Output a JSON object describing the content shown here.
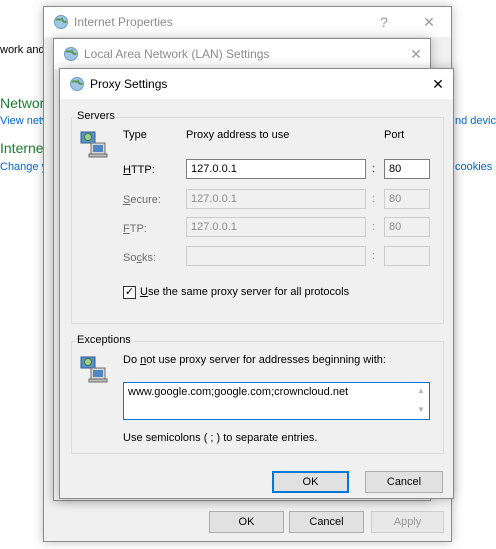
{
  "background_page": {
    "network_heading": "Networ",
    "network_link": "View netw",
    "internet_heading": "Interne",
    "internet_link": "Change y",
    "right_link_1": "nd devic",
    "right_link_2": "cookies",
    "top_fragment": "work and"
  },
  "internet_properties": {
    "title": "Internet Properties",
    "help_glyph": "?",
    "close_glyph": "✕",
    "ok_label": "OK",
    "cancel_label": "Cancel",
    "apply_label": "Apply"
  },
  "lan_settings": {
    "title": "Local Area Network (LAN) Settings",
    "close_glyph": "✕"
  },
  "proxy_settings": {
    "title": "Proxy Settings",
    "close_glyph": "✕",
    "servers": {
      "group_label": "Servers",
      "col_type": "Type",
      "col_address": "Proxy address to use",
      "col_port": "Port",
      "rows": [
        {
          "access_key": "H",
          "rest": "TTP:",
          "address": "127.0.0.1",
          "port": "80"
        },
        {
          "access_key": "S",
          "rest": "ecure:",
          "address": "127.0.0.1",
          "port": "80"
        },
        {
          "access_key": "F",
          "rest": "TP:",
          "address": "127.0.0.1",
          "port": "80"
        },
        {
          "prefix": "So",
          "access_key": "c",
          "rest": "ks:",
          "address": "",
          "port": ""
        }
      ],
      "colon": ":",
      "same_proxy_prefix": "",
      "same_proxy_key": "U",
      "same_proxy_rest": "se the same proxy server for all protocols",
      "same_proxy_checked": true,
      "check_glyph": "✓"
    },
    "exceptions": {
      "group_label": "Exceptions",
      "desc_prefix": "Do ",
      "desc_key": "n",
      "desc_rest": "ot use proxy server for addresses beginning with:",
      "value": "www.google.com;google.com;crowncloud.net",
      "hint": "Use semicolons ( ; ) to separate entries.",
      "scroll_up": "▲",
      "scroll_down": "▼"
    },
    "ok_label": "OK",
    "cancel_label": "Cancel"
  }
}
